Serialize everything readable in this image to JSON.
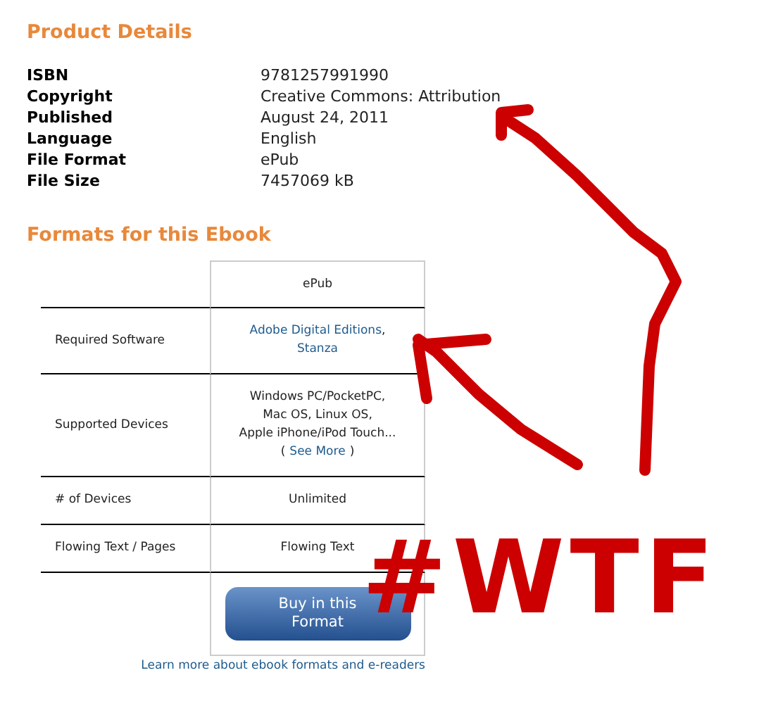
{
  "product_details": {
    "heading": "Product Details",
    "rows": [
      {
        "label": "ISBN",
        "value": "9781257991990"
      },
      {
        "label": "Copyright",
        "value": "Creative Commons: Attribution"
      },
      {
        "label": "Published",
        "value": "August 24, 2011"
      },
      {
        "label": "Language",
        "value": "English"
      },
      {
        "label": "File Format",
        "value": "ePub"
      },
      {
        "label": "File Size",
        "value": "7457069 kB"
      }
    ]
  },
  "formats": {
    "heading": "Formats for this Ebook",
    "column": "ePub",
    "rows": [
      {
        "label": "Required Software",
        "lines": [
          {
            "links": [
              "Adobe Digital Editions"
            ],
            "after": ","
          },
          {
            "links": [
              "Stanza"
            ]
          }
        ]
      },
      {
        "label": "Supported Devices",
        "lines": [
          {
            "text": "Windows PC/PocketPC,"
          },
          {
            "text": "Mac OS, Linux OS,"
          },
          {
            "text": "Apple iPhone/iPod Touch..."
          },
          {
            "before": "(",
            "links": [
              "See More"
            ],
            "after": ")"
          }
        ]
      },
      {
        "label": "# of Devices",
        "lines": [
          {
            "text": "Unlimited"
          }
        ]
      },
      {
        "label": "Flowing Text / Pages",
        "lines": [
          {
            "text": "Flowing Text"
          }
        ]
      }
    ],
    "button": "Buy in this Format",
    "learn_more": "Learn more about ebook formats and e-readers"
  },
  "annotation": {
    "text": "#WTF"
  }
}
